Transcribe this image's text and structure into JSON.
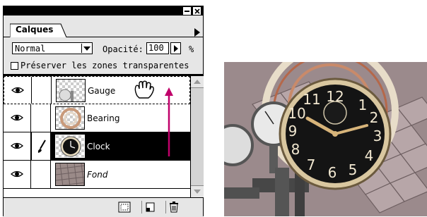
{
  "panel": {
    "tab_label": "Calques",
    "blend_mode": "Normal",
    "opacity_label": "Opacité:",
    "opacity_value": "100",
    "percent_sign": "%",
    "preserve_label": "Préserver les zones transparentes",
    "preserve_checked": false
  },
  "layers": [
    {
      "name": "Gauge",
      "visible": true,
      "selected": false,
      "italic": false,
      "target": true
    },
    {
      "name": "Bearing",
      "visible": true,
      "selected": false,
      "italic": false
    },
    {
      "name": "Clock",
      "visible": true,
      "selected": true,
      "italic": false,
      "brush": true
    },
    {
      "name": "Fond",
      "visible": true,
      "selected": false,
      "italic": true
    }
  ],
  "icons": {
    "window_min": "minimize-icon",
    "window_close": "close-icon",
    "panel_menu": "triangle-right-icon",
    "visibility": "eye-icon",
    "brush": "paintbrush-icon",
    "cursor": "grab-hand-icon",
    "drag_arrow": "arrow-up-icon",
    "new_mask": "layer-mask-icon",
    "new_layer": "new-layer-icon",
    "delete": "trash-icon"
  },
  "colors": {
    "drag_arrow": "#c0006a",
    "selected_row": "#000000",
    "panel_bg": "#e6e6e6"
  }
}
